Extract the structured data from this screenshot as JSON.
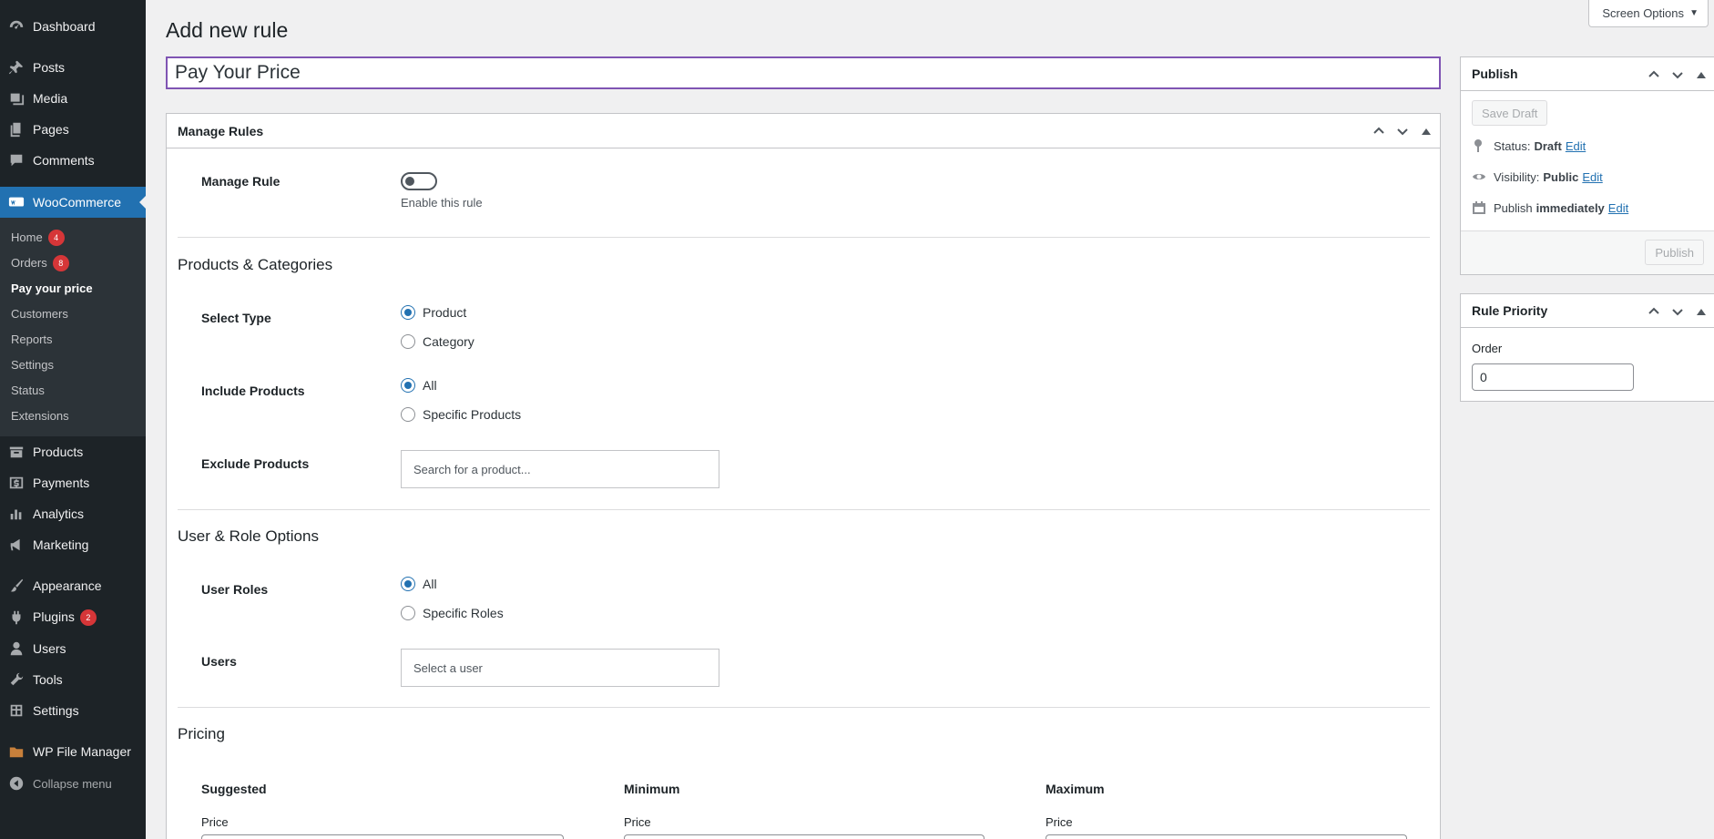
{
  "sidebar": {
    "items": [
      {
        "label": "Dashboard",
        "icon": "dashboard-icon"
      },
      {
        "label": "Posts",
        "icon": "pin-icon"
      },
      {
        "label": "Media",
        "icon": "media-icon"
      },
      {
        "label": "Pages",
        "icon": "pages-icon"
      },
      {
        "label": "Comments",
        "icon": "comment-icon"
      },
      {
        "label": "WooCommerce",
        "icon": "woo-icon"
      },
      {
        "label": "Products",
        "icon": "archive-icon"
      },
      {
        "label": "Payments",
        "icon": "dollar-icon"
      },
      {
        "label": "Analytics",
        "icon": "chart-icon"
      },
      {
        "label": "Marketing",
        "icon": "megaphone-icon"
      },
      {
        "label": "Appearance",
        "icon": "brush-icon"
      },
      {
        "label": "Plugins",
        "icon": "plug-icon",
        "count": "2"
      },
      {
        "label": "Users",
        "icon": "user-icon"
      },
      {
        "label": "Tools",
        "icon": "wrench-icon"
      },
      {
        "label": "Settings",
        "icon": "settings-icon"
      },
      {
        "label": "WP File Manager",
        "icon": "folder-icon"
      },
      {
        "label": "Collapse menu",
        "icon": "collapse-icon"
      }
    ],
    "submenu": [
      {
        "label": "Home",
        "count": "4"
      },
      {
        "label": "Orders",
        "count": "8"
      },
      {
        "label": "Pay your price"
      },
      {
        "label": "Customers"
      },
      {
        "label": "Reports"
      },
      {
        "label": "Settings"
      },
      {
        "label": "Status"
      },
      {
        "label": "Extensions"
      }
    ]
  },
  "header": {
    "screen_options": "Screen Options",
    "page_title": "Add new rule",
    "title_value": "Pay Your Price"
  },
  "manage_rules": {
    "title": "Manage Rules",
    "manage_rule_label": "Manage Rule",
    "toggle_hint": "Enable this rule",
    "toggle_on": false
  },
  "products": {
    "title": "Products & Categories",
    "select_type_label": "Select Type",
    "select_type_options": [
      "Product",
      "Category"
    ],
    "include_label": "Include Products",
    "include_options": [
      "All",
      "Specific Products"
    ],
    "exclude_label": "Exclude Products",
    "exclude_placeholder": "Search for a product..."
  },
  "users": {
    "title": "User & Role Options",
    "roles_label": "User Roles",
    "roles_options": [
      "All",
      "Specific Roles"
    ],
    "users_label": "Users",
    "users_placeholder": "Select a user"
  },
  "pricing": {
    "title": "Pricing",
    "columns": [
      {
        "title": "Suggested",
        "label": "Price"
      },
      {
        "title": "Minimum",
        "label": "Price"
      },
      {
        "title": "Maximum",
        "label": "Price"
      }
    ]
  },
  "publish": {
    "title": "Publish",
    "save_draft": "Save Draft",
    "status_label": "Status:",
    "status_value": "Draft",
    "visibility_label": "Visibility:",
    "visibility_value": "Public",
    "publish_label": "Publish",
    "publish_value": "immediately",
    "edit": "Edit",
    "publish_button": "Publish"
  },
  "priority": {
    "title": "Rule Priority",
    "order_label": "Order",
    "order_value": "0"
  },
  "colors": {
    "accent": "#2271b1",
    "sidebar_bg": "#1d2327",
    "focus": "#7f54b3",
    "badge": "#d63638"
  }
}
